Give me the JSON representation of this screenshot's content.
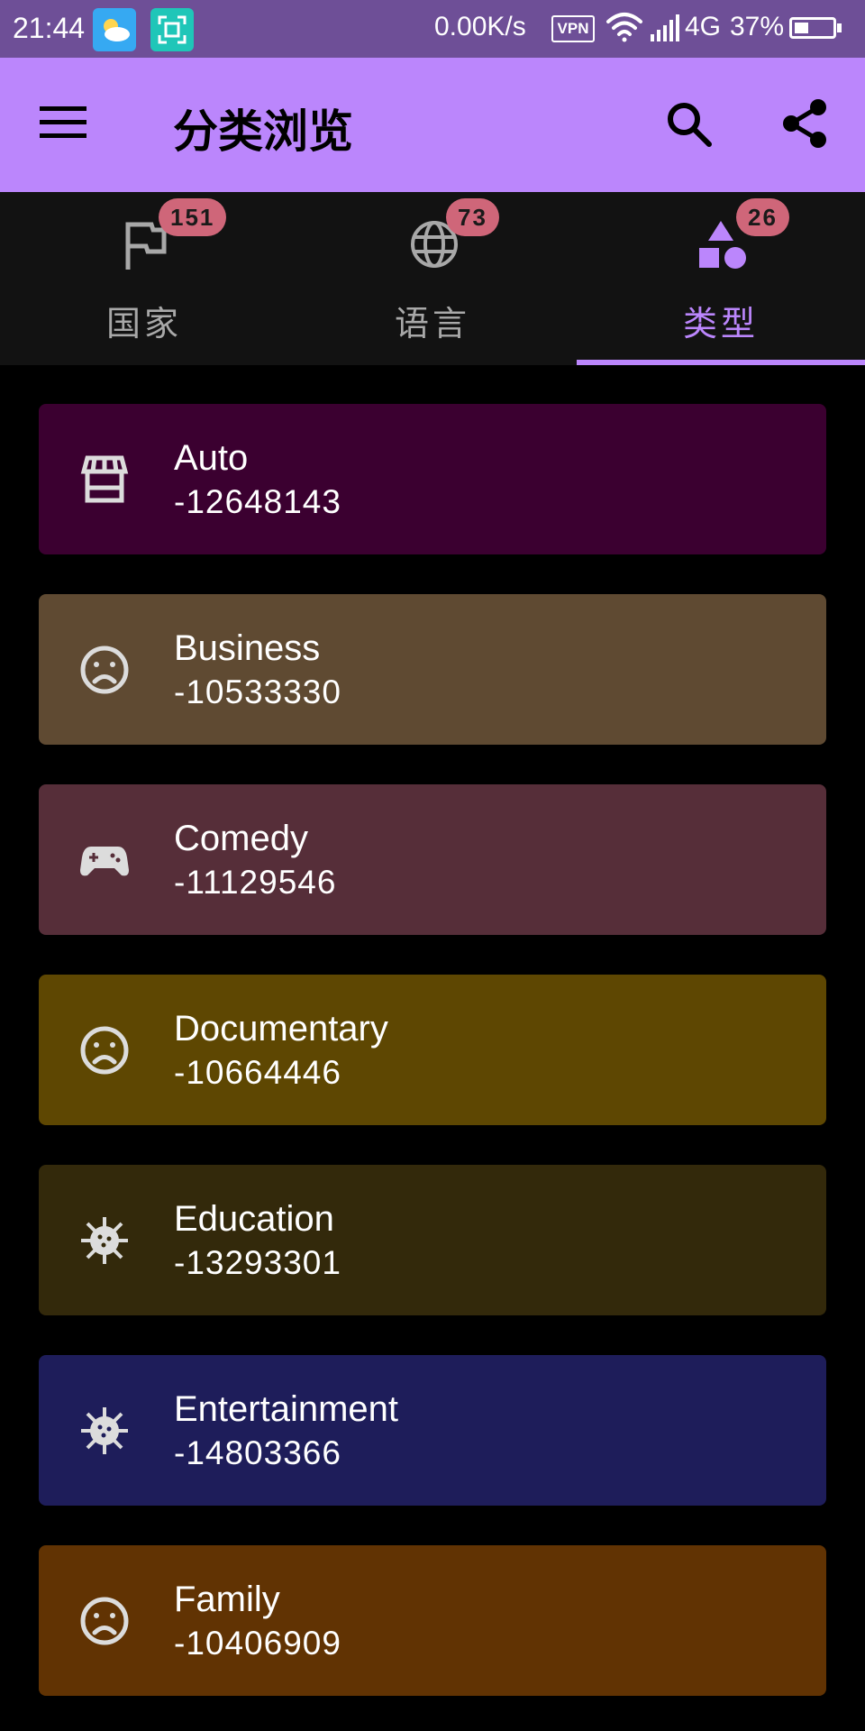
{
  "status_bar": {
    "time": "21:44",
    "net_speed": "0.00K/s",
    "vpn": "VPN",
    "network": "4G",
    "battery": "37%",
    "battery_level": 0.37
  },
  "app_bar": {
    "title": "分类浏览",
    "menu_icon": "hamburger-menu-icon",
    "search_icon": "search-icon",
    "share_icon": "share-icon",
    "background": "#bb86fc"
  },
  "tabs": [
    {
      "label": "国家",
      "badge": "151",
      "icon": "flag-icon",
      "active": false
    },
    {
      "label": "语言",
      "badge": "73",
      "icon": "globe-icon",
      "active": false
    },
    {
      "label": "类型",
      "badge": "26",
      "icon": "shapes-icon",
      "active": true
    }
  ],
  "colors": {
    "accent": "#bb86fc",
    "badge": "#cf6679",
    "tab_bg": "#121212",
    "inactive_text": "#a8a8a8"
  },
  "categories": [
    {
      "title": "Auto",
      "value": "-12648143",
      "icon": "storefront-icon",
      "color": "#3b0030"
    },
    {
      "title": "Business",
      "value": "-10533330",
      "icon": "sad-face-icon",
      "color": "#5f4a32"
    },
    {
      "title": "Comedy",
      "value": "-11129546",
      "icon": "gamepad-icon",
      "color": "#562e39"
    },
    {
      "title": "Documentary",
      "value": "-10664446",
      "icon": "sad-face-icon",
      "color": "#5e4702"
    },
    {
      "title": "Education",
      "value": "-13293301",
      "icon": "virus-icon",
      "color": "#33290b"
    },
    {
      "title": "Entertainment",
      "value": "-14803366",
      "icon": "virus-icon",
      "color": "#1e1d5a"
    },
    {
      "title": "Family",
      "value": "-10406909",
      "icon": "sad-face-icon",
      "color": "#613303"
    }
  ]
}
